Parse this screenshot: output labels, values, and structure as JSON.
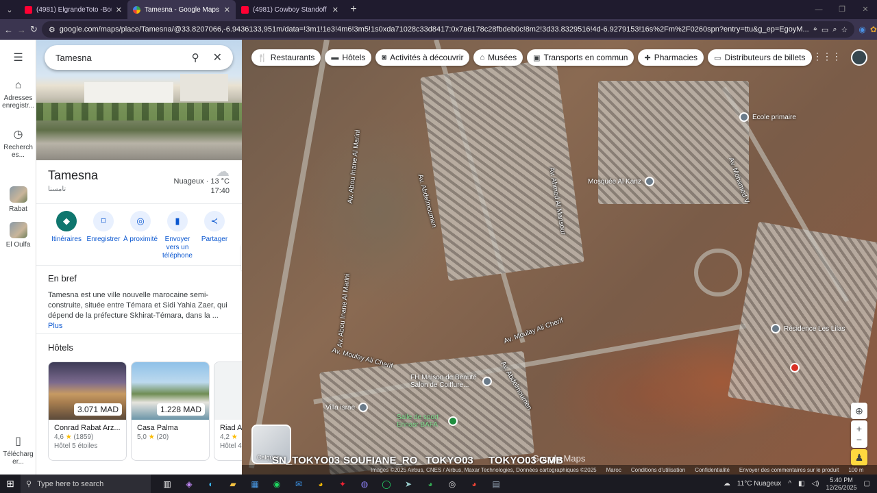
{
  "browser": {
    "tabs": [
      {
        "title": "(4981) ElgrandeToto -Bouhali- ",
        "favicon": "youtube-icon",
        "active": false
      },
      {
        "title": "Tamesna - Google Maps",
        "favicon": "google-maps-icon",
        "active": true
      },
      {
        "title": "(4981) Cowboy Standoff Music",
        "favicon": "youtube-icon",
        "active": false
      }
    ],
    "url": "google.com/maps/place/Tamesna/@33.8207066,-6.9436133,951m/data=!3m1!1e3!4m6!3m5!1s0xda71028c33d8417:0x7a6178c28fbdeb0c!8m2!3d33.8329516!4d-6.9279153!16s%2Fm%2F0260spn?entry=ttu&g_ep=EgoyM..."
  },
  "rail": {
    "saved_label": "Adresses enregistr...",
    "recent_label": "Recherch es...",
    "recent_places": [
      "Rabat",
      "El Oulfa"
    ],
    "download_label": "Télécharg er..."
  },
  "search": {
    "query": "Tamesna"
  },
  "place": {
    "name": "Tamesna",
    "arabic_name": "تامسنا",
    "weather": "Nuageux · 13 °C",
    "time": "17:40"
  },
  "actions": [
    {
      "label": "Itinéraires",
      "icon": "directions-icon"
    },
    {
      "label": "Enregistrer",
      "icon": "bookmark-icon"
    },
    {
      "label": "À proximité",
      "icon": "nearby-icon"
    },
    {
      "label": "Envoyer vers un téléphone",
      "icon": "phone-icon"
    },
    {
      "label": "Partager",
      "icon": "share-icon"
    }
  ],
  "brief": {
    "heading": "En bref",
    "text": "Tamesna est une ville nouvelle marocaine semi-construite, située entre Témara et Sidi Yahia Zaer, qui dépend de la préfecture Skhirat-Témara, dans la ...",
    "more": "Plus"
  },
  "hotels": {
    "heading": "Hôtels",
    "items": [
      {
        "name": "Conrad Rabat Arz...",
        "price": "3.071 MAD",
        "rating": "4,6",
        "reviews": "(1859)",
        "class": "Hôtel 5 étoiles"
      },
      {
        "name": "Casa Palma",
        "price": "1.228 MAD",
        "rating": "5,0",
        "reviews": "(20)",
        "class": ""
      },
      {
        "name": "Riad A",
        "price": "",
        "rating": "4,2",
        "reviews": "",
        "class": "Hôtel 4"
      }
    ]
  },
  "map": {
    "chips": [
      {
        "label": "Restaurants",
        "icon": "fork-knife-icon"
      },
      {
        "label": "Hôtels",
        "icon": "bed-icon"
      },
      {
        "label": "Activités à découvrir",
        "icon": "camera-icon"
      },
      {
        "label": "Musées",
        "icon": "museum-icon"
      },
      {
        "label": "Transports en commun",
        "icon": "bus-icon"
      },
      {
        "label": "Pharmacies",
        "icon": "pharmacy-icon"
      },
      {
        "label": "Distributeurs de billets",
        "icon": "atm-icon"
      }
    ],
    "street_labels": [
      "Av. Abou Inane Al Marini",
      "Av. Abou Inane Al Marini",
      "Av. Abdelmoumen",
      "Av. Ahmed Al Mansour",
      "Av. Moulay Ali Cherif",
      "Av. Moulay Ali Cherif",
      "Av. Abdelmoumen",
      "Av. Mohamed V"
    ],
    "pois": [
      {
        "name": "Mosquée Al Kanz",
        "color": "gray"
      },
      {
        "name": "Ecole primaire",
        "color": "gray"
      },
      {
        "name": "Résidence Les Lilas",
        "color": "gray"
      },
      {
        "name": "FH Maison de Beauté Salon de Coiffure...",
        "color": "gray"
      },
      {
        "name": "Villa israe",
        "color": "gray"
      },
      {
        "name": "Salle de sport Ennasr BAFA",
        "color": "green"
      }
    ],
    "layers_label": "Calques",
    "watermarks": [
      "SN_TOKYO03",
      "SOUFIANE_RO",
      "TOKYO03",
      "TOKYO03 GMB"
    ],
    "google_logo": "Google Maps",
    "attribution": [
      "Images ©2025 Airbus, CNES / Airbus, Maxar Technologies, Données cartographiques ©2025",
      "Maroc",
      "Conditions d'utilisation",
      "Confidentialité",
      "Envoyer des commentaires sur le produit",
      "100 m"
    ]
  },
  "taskbar": {
    "search_placeholder": "Type here to search",
    "weather": "11°C Nuageux",
    "time": "5:40 PM",
    "date": "12/26/2025"
  }
}
